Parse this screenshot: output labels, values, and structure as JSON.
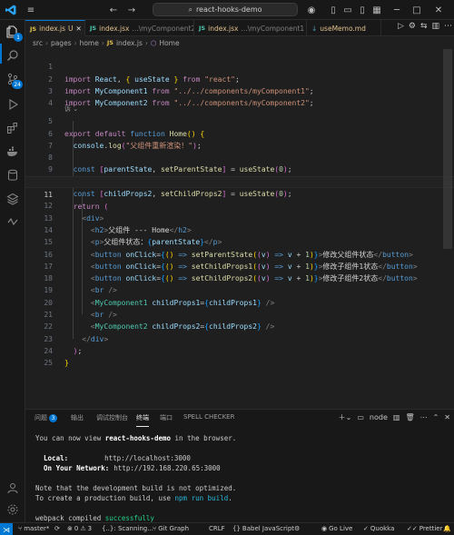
{
  "titlebar": {
    "search_text": "react-hooks-demo"
  },
  "activity": {
    "explorer_badge": "1",
    "scm_badge": "24"
  },
  "tabs": [
    {
      "name": "index.js",
      "status": "U"
    },
    {
      "name": "index.jsx",
      "path": "...\\myComponent2",
      "status": "U"
    },
    {
      "name": "index.jsx",
      "path": "...\\myComponent1",
      "status": "U"
    },
    {
      "name": "useMemo.md",
      "status": ""
    }
  ],
  "breadcrumb": [
    "src",
    "pages",
    "home",
    "index.js",
    "Home"
  ],
  "code_lines": [
    "1",
    "2",
    "3",
    "4",
    "5",
    "6",
    "7",
    "8",
    "9",
    "10",
    "11",
    "12",
    "13",
    "14",
    "15",
    "16",
    "17",
    "18",
    "19",
    "20",
    "21",
    "22",
    "23",
    "24",
    "25"
  ],
  "code": {
    "l1_kw": "import",
    "l1_a": "React",
    "l1_b": "useState",
    "l1_from": "from",
    "l1_src": "\"react\"",
    "l2_kw": "import",
    "l2_a": "MyComponent1",
    "l2_from": "from",
    "l2_src": "\"../../components/myComponent1\"",
    "l3_kw": "import",
    "l3_a": "MyComponent2",
    "l3_from": "from",
    "l3_src": "\"../../components/myComponent2\"",
    "l4_hint": "诉",
    "l5_a": "export",
    "l5_b": "default",
    "l5_c": "function",
    "l5_d": "Home",
    "l6_a": "console",
    "l6_b": "log",
    "l6_s": "\"父组件重新渲染！\"",
    "l8_a": "parentState",
    "l8_b": "setParentState",
    "l9_a": "childProps1",
    "l9_b": "setChildProps1",
    "l10_a": "childProps2",
    "l10_b": "setChildProps2",
    "use_state": "useState",
    "zero": "0",
    "const": "const",
    "l11": "return",
    "l12": "div",
    "l13_text": "父组件 --- Home",
    "l14_text": "父组件状态：",
    "l14_var": "parentState",
    "btn_tag": "button",
    "onclick": "onClick",
    "l15_fn": "setParentState",
    "l15_text": "修改父组件状态",
    "l16_fn": "setChildProps1",
    "l16_text": "修改子组件1状态",
    "l17_fn": "setChildProps2",
    "l17_text": "修改子组件2状态",
    "br": "br",
    "l19_comp": "MyComponent1",
    "l19_attr": "childProps1",
    "l21_comp": "MyComponent2",
    "l21_attr": "childProps2",
    "v_param": "v",
    "one": "1"
  },
  "panel": {
    "tabs": [
      "问题",
      "输出",
      "调试控制台",
      "终端",
      "端口",
      "SPELL CHECKER"
    ],
    "problems_badge": "3",
    "active_tab": "终端",
    "node_label": "node"
  },
  "terminal": {
    "line1_pre": "You can now view ",
    "line1_app": "react-hooks-demo",
    "line1_post": " in the browser.",
    "local_label": "  Local:",
    "local_url": "http://localhost:3000",
    "network_label": "  On Your Network:",
    "network_url": "http://192.168.220.65:3000",
    "note1": "Note that the development build is not optimized.",
    "note2_pre": "To create a production build, use ",
    "note2_cmd": "npm run build",
    "note2_post": ".",
    "compiled_pre": "webpack compiled ",
    "compiled_status": "successfully"
  },
  "statusbar": {
    "branch": "master*",
    "errors": "0",
    "warnings": "3",
    "scanning": "{..}: Scanning...",
    "graph": "Git Graph",
    "eol": "CRLF",
    "language": "Babel JavaScript",
    "live": "Go Live",
    "quokka": "Quokka",
    "prettier": "Prettier"
  },
  "colors": {
    "accent": "#0078d4",
    "bg": "#1f1f1f"
  }
}
